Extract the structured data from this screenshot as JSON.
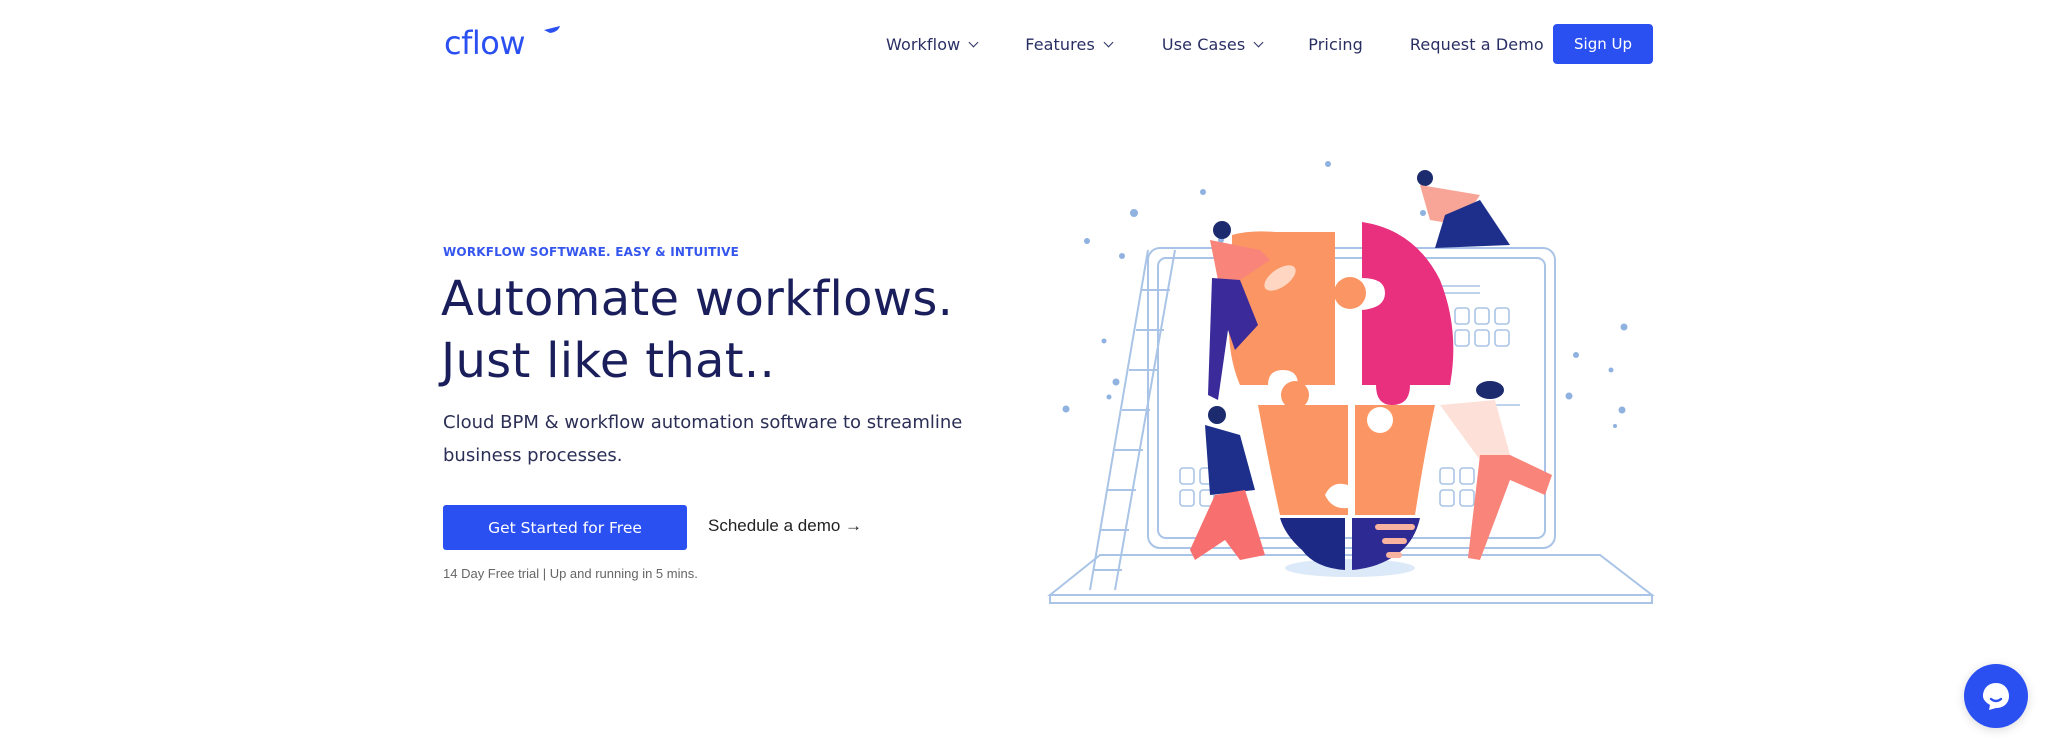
{
  "brand": {
    "logo_text": "cflow",
    "accent": "#2b50f2",
    "headline_color": "#1a1f5c"
  },
  "nav": {
    "items": [
      {
        "label": "Workflow",
        "has_dropdown": true
      },
      {
        "label": "Features",
        "has_dropdown": true
      },
      {
        "label": "Use Cases",
        "has_dropdown": true
      },
      {
        "label": "Pricing",
        "has_dropdown": false
      },
      {
        "label": "Request a Demo",
        "has_dropdown": false
      }
    ],
    "signup_label": "Sign Up"
  },
  "hero": {
    "eyebrow": "WORKFLOW SOFTWARE. EASY & INTUITIVE",
    "headline_line1": "Automate workflows.",
    "headline_line2": "Just like that..",
    "subtext": "Cloud BPM & workflow automation software to streamline business processes.",
    "cta_label": "Get Started for Free",
    "demo_link_label": "Schedule a demo →",
    "trial_note": "14 Day Free trial | Up and running in 5 mins."
  },
  "illustration": {
    "description": "team assembling lightbulb puzzle pieces over laptop"
  },
  "chat": {
    "icon": "chat-bubble-icon"
  }
}
